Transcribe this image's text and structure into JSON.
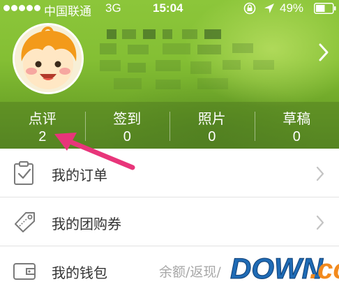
{
  "status_bar": {
    "carrier": "中国联通",
    "network": "3G",
    "time": "15:04",
    "battery": "49%"
  },
  "stats": [
    {
      "label": "点评",
      "count": "2"
    },
    {
      "label": "签到",
      "count": "0"
    },
    {
      "label": "照片",
      "count": "0"
    },
    {
      "label": "草稿",
      "count": "0"
    }
  ],
  "menu": [
    {
      "label": "我的订单",
      "icon": "clipboard-check-icon"
    },
    {
      "label": "我的团购券",
      "icon": "coupon-tag-icon"
    },
    {
      "label": "我的钱包",
      "icon": "wallet-icon",
      "sub": "余额/返现/"
    }
  ],
  "watermark": {
    "text": "DOWN.cc"
  },
  "colors": {
    "header_green": "#84bf34",
    "annotation_pink": "#e8357a",
    "watermark_blue": "#1f6bb5",
    "watermark_orange": "#f28a1e"
  }
}
